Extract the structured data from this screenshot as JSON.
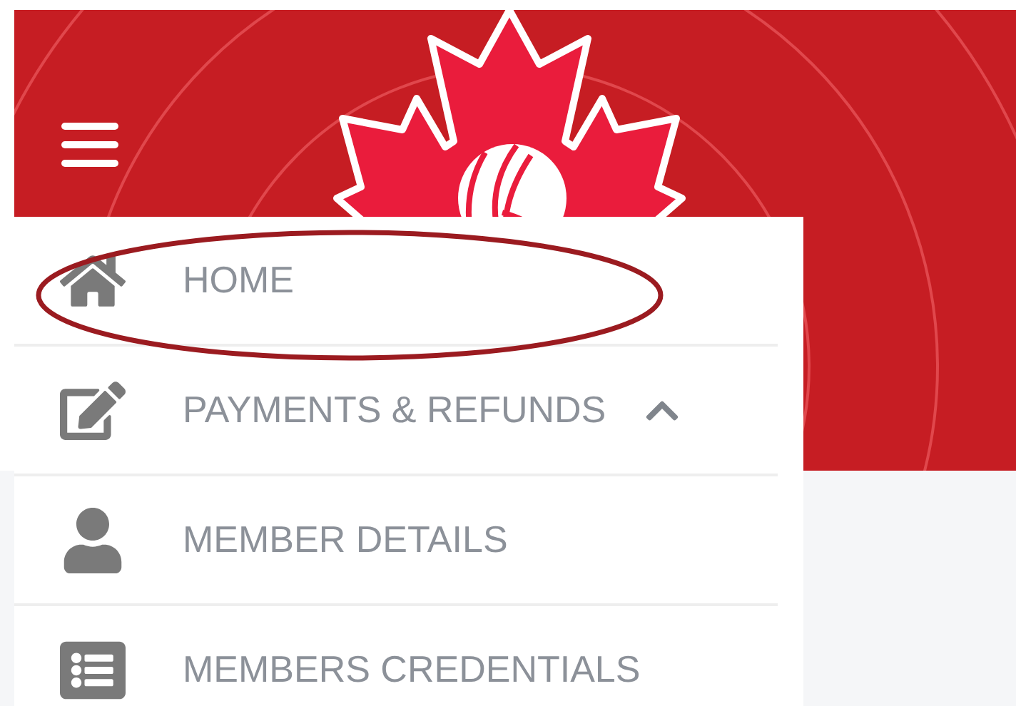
{
  "menu": {
    "items": [
      {
        "label": "HOME",
        "highlighted": true
      },
      {
        "label": "PAYMENTS & REFUNDS",
        "highlighted": false,
        "expanded": true
      },
      {
        "label": "MEMBER DETAILS",
        "highlighted": false
      },
      {
        "label": "MEMBERS CREDENTIALS",
        "highlighted": false
      }
    ]
  }
}
